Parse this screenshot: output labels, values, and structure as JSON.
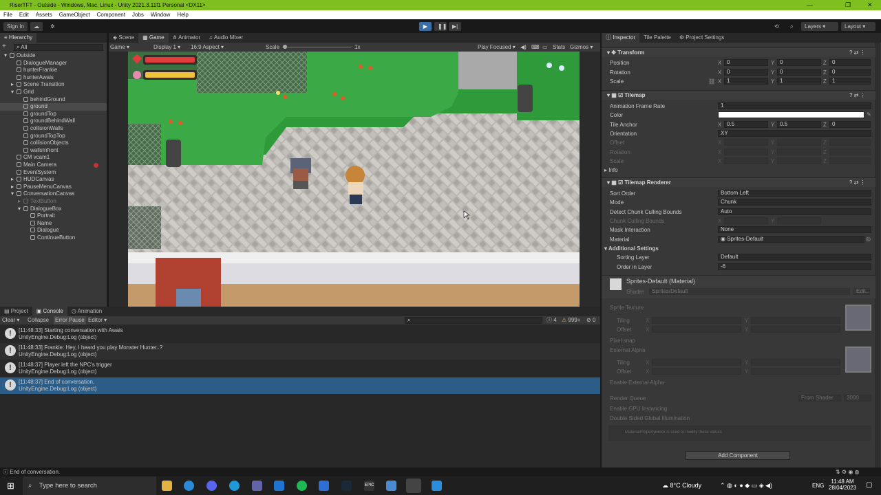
{
  "window": {
    "title": "RiserTFT - Outside - Windows, Mac, Linux - Unity 2021.3.11f1 Personal <DX11>"
  },
  "menu": [
    "File",
    "Edit",
    "Assets",
    "GameObject",
    "Component",
    "Jobs",
    "Window",
    "Help"
  ],
  "toolbar": {
    "sign_in": "Sign In",
    "layers": "Layers",
    "layout": "Layout"
  },
  "hierarchy": {
    "tab": "Hierarchy",
    "search_placeholder": "All",
    "items": [
      {
        "label": "Outside",
        "indent": 0,
        "arrow": "▾"
      },
      {
        "label": "DialogueManager",
        "indent": 1
      },
      {
        "label": "hunterFrankie",
        "indent": 1
      },
      {
        "label": "hunterAwais",
        "indent": 1
      },
      {
        "label": "Scene Transition",
        "indent": 1,
        "arrow": "▸"
      },
      {
        "label": "Grid",
        "indent": 1,
        "arrow": "▾"
      },
      {
        "label": "behindGround",
        "indent": 2
      },
      {
        "label": "ground",
        "indent": 2,
        "selected": true
      },
      {
        "label": "groundTop",
        "indent": 2
      },
      {
        "label": "groundBehindWall",
        "indent": 2
      },
      {
        "label": "collisionWalls",
        "indent": 2
      },
      {
        "label": "groundTopTop",
        "indent": 2
      },
      {
        "label": "collisionObjects",
        "indent": 2
      },
      {
        "label": "wallsInfront",
        "indent": 2
      },
      {
        "label": "CM vcam1",
        "indent": 1
      },
      {
        "label": "Main Camera",
        "indent": 1
      },
      {
        "label": "EventSystem",
        "indent": 1
      },
      {
        "label": "HUDCanvas",
        "indent": 1,
        "arrow": "▸"
      },
      {
        "label": "PauseMenuCanvas",
        "indent": 1,
        "arrow": "▸"
      },
      {
        "label": "ConversationCanvas",
        "indent": 1,
        "arrow": "▾"
      },
      {
        "label": "TextButton",
        "indent": 2,
        "disabled": true,
        "arrow": "▸"
      },
      {
        "label": "DialogueBox",
        "indent": 2,
        "arrow": "▾"
      },
      {
        "label": "Portrait",
        "indent": 3
      },
      {
        "label": "Name",
        "indent": 3
      },
      {
        "label": "Dialogue",
        "indent": 3
      },
      {
        "label": "ContinueButton",
        "indent": 3
      }
    ]
  },
  "center_tabs": [
    "Scene",
    "Game",
    "Animator",
    "Audio Mixer"
  ],
  "game_bar": {
    "mode": "Game",
    "display": "Display 1",
    "aspect": "16:9 Aspect",
    "scale_label": "Scale",
    "scale_value": "1x",
    "play_focused": "Play Focused",
    "stats": "Stats",
    "gizmos": "Gizmos"
  },
  "bottom_tabs": [
    "Project",
    "Console",
    "Animation"
  ],
  "console_bar": {
    "clear": "Clear",
    "collapse": "Collapse",
    "error_pause": "Error Pause",
    "editor": "Editor",
    "info_count": "4",
    "warn_count": "999+",
    "err_count": "0"
  },
  "console": [
    {
      "line1": "[11:48:33] Starting conversation with Awais",
      "line2": "UnityEngine.Debug:Log (object)"
    },
    {
      "line1": "[11:48:33] Frankie: Hey, I heard you play Monster Hunter..?",
      "line2": "UnityEngine.Debug:Log (object)"
    },
    {
      "line1": "[11:48:37] Player left the NPC's trigger",
      "line2": "UnityEngine.Debug:Log (object)"
    },
    {
      "line1": "[11:48:37] End of conversation.",
      "line2": "UnityEngine.Debug:Log (object)",
      "selected": true
    }
  ],
  "status_text": "End of conversation.",
  "inspector": {
    "tabs": [
      "Inspector",
      "Tile Palette",
      "Project Settings"
    ],
    "transform": {
      "title": "Transform",
      "position": [
        "0",
        "0",
        "0"
      ],
      "rotation": [
        "0",
        "0",
        "0"
      ],
      "scale": [
        "1",
        "1",
        "1"
      ],
      "labels": [
        "Position",
        "Rotation",
        "Scale"
      ]
    },
    "tilemap": {
      "title": "Tilemap",
      "frame_rate_label": "Animation Frame Rate",
      "frame_rate": "1",
      "color_label": "Color",
      "anchor_label": "Tile Anchor",
      "anchor": [
        "0.5",
        "0.5",
        "0"
      ],
      "orientation_label": "Orientation",
      "orientation": "XY",
      "offset_label": "Offset",
      "rotation_label": "Rotation",
      "scale_label": "Scale",
      "info_label": "Info"
    },
    "renderer": {
      "title": "Tilemap Renderer",
      "sort_order_label": "Sort Order",
      "sort_order": "Bottom Left",
      "mode_label": "Mode",
      "mode": "Chunk",
      "detect_label": "Detect Chunk Culling Bounds",
      "detect": "Auto",
      "chunk_label": "Chunk Culling Bounds",
      "mask_label": "Mask Interaction",
      "mask": "None",
      "material_label": "Material",
      "material": "Sprites-Default",
      "additional": "Additional Settings",
      "sorting_layer_label": "Sorting Layer",
      "sorting_layer": "Default",
      "order_label": "Order in Layer",
      "order": "-6"
    },
    "material_block": {
      "title": "Sprites-Default (Material)",
      "shader_label": "Shader",
      "shader": "Sprites/Default",
      "edit": "Edit...",
      "sprite_texture": "Sprite Texture",
      "tiling": "Tiling",
      "offset": "Offset",
      "pixel_snap": "Pixel snap",
      "external_alpha": "External Alpha",
      "enable_external_alpha": "Enable External Alpha",
      "render_queue": "Render Queue",
      "from_shader": "From Shader",
      "queue_value": "3000",
      "gpu_instancing": "Enable GPU Instancing",
      "double_sided": "Double Sided Global Illumination",
      "mpb_note": "MaterialPropertyBlock is used to modify these values"
    },
    "add_component": "Add Component"
  },
  "taskbar": {
    "search_placeholder": "Type here to search",
    "weather": "8°C  Cloudy",
    "lang": "ENG",
    "time": "11:48 AM",
    "date": "28/04/2023"
  }
}
